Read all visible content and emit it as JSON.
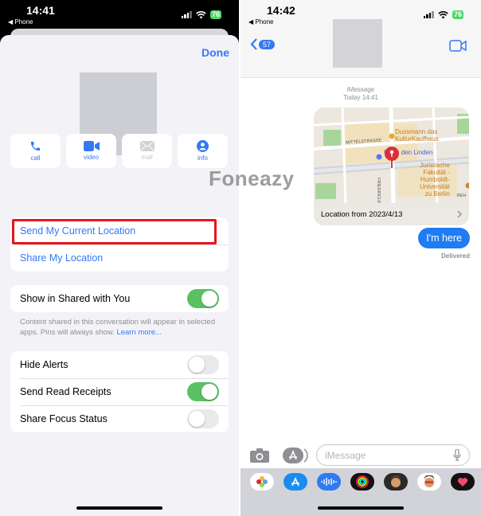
{
  "left_screen": {
    "status_bar": {
      "time": "14:41",
      "back_app": "◀ Phone",
      "battery": "76"
    },
    "done_label": "Done",
    "actions": [
      {
        "label": "call",
        "icon": "phone-icon",
        "enabled": true
      },
      {
        "label": "video",
        "icon": "video-icon",
        "enabled": true
      },
      {
        "label": "mail",
        "icon": "mail-icon",
        "enabled": false
      },
      {
        "label": "info",
        "icon": "person-icon",
        "enabled": true
      }
    ],
    "location_group": [
      {
        "label": "Send My Current Location",
        "highlighted": true
      },
      {
        "label": "Share My Location",
        "highlighted": false
      }
    ],
    "shared_with_you": {
      "label": "Show in Shared with You",
      "on": true
    },
    "footnote": {
      "text": "Content shared in this conversation will appear in selected apps. Pins will always show.",
      "link": "Learn more..."
    },
    "settings": [
      {
        "label": "Hide Alerts",
        "on": false
      },
      {
        "label": "Send Read Receipts",
        "on": true
      },
      {
        "label": "Share Focus Status",
        "on": false
      }
    ]
  },
  "right_screen": {
    "status_bar": {
      "time": "14:42",
      "back_app": "◀ Phone",
      "battery": "76"
    },
    "unread_badge": "57",
    "meta": {
      "service": "iMessage",
      "timestamp": "Today 14:41"
    },
    "map": {
      "labels": [
        "Dussmann das",
        "KulturKaufhaus",
        "MITTELSTRASSE",
        "Unter den Linden",
        "Juristische",
        "Fakultät -",
        "Humboldt-",
        "Universität",
        "zu Berlin",
        "FRIEDRICHSTR",
        "BEH"
      ],
      "caption": "Location from 2023/4/13"
    },
    "message": "I'm here",
    "delivery_status": "Delivered",
    "input_placeholder": "iMessage",
    "apps": [
      "photos",
      "app-store",
      "audio",
      "fitness",
      "memoji",
      "memoji-stickers",
      "digital-touch"
    ]
  },
  "watermark": "Foneazy",
  "colors": {
    "accent": "#3478f6",
    "toggle_on": "#5ac062",
    "highlight": "#e8141a",
    "bubble": "#1f7cf4"
  }
}
